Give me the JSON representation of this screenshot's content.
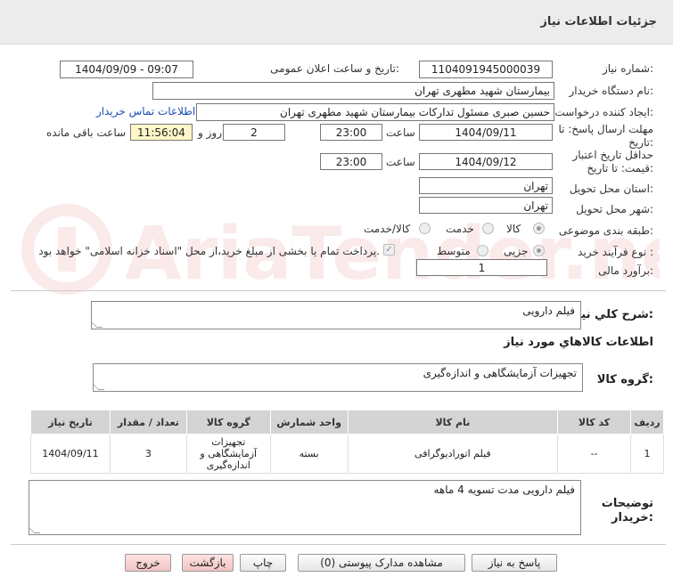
{
  "header": {
    "title": "جزئیات اطلاعات نیاز"
  },
  "labels": {
    "need_number": "شماره نیاز:",
    "announce_datetime": "تاریخ و ساعت اعلان عمومی:",
    "buyer_org": "نام دستگاه خریدار:",
    "requester": "ایجاد کننده درخواست:",
    "contact_link": "اطلاعات تماس خریدار",
    "reply_deadline_1": "مهلت ارسال پاسخ: تا",
    "reply_deadline_2": "تاریخ:",
    "time": "ساعت",
    "day_and": "روز و",
    "remaining": "ساعت باقی مانده",
    "validity_1": "حداقل تاریخ اعتبار",
    "validity_2": "قیمت: تا تاریخ:",
    "province": "استان محل تحویل:",
    "city": "شهر محل تحویل:",
    "category": "طبقه بندی موضوعی:",
    "purchase_type": "نوع فرآیند خرید :",
    "budget": "برآورد مالی:",
    "need_summary": "شرح كلي نياز:",
    "goods_info": "اطلاعات كالاهاي مورد نياز",
    "goods_group": "گروه کالا:",
    "buyer_notes_1": "توضیحات",
    "buyer_notes_2": "خریدار:"
  },
  "values": {
    "need_number": "1104091945000039",
    "announce_datetime": "1404/09/09 - 09:07",
    "buyer_org": "بیمارستان شهید مطهری تهران",
    "requester": "حسین صبری مسئول تدارکات بیمارستان شهید مطهری تهران",
    "reply_date": "1404/09/11",
    "reply_time": "23:00",
    "days": "2",
    "remaining_time": "11:56:04",
    "validity_date": "1404/09/12",
    "validity_time": "23:00",
    "province": "تهران",
    "city": "تهران",
    "budget": "1",
    "need_summary": "فیلم دارویی",
    "goods_group": "تجهیزات آزمایشگاهی و اندازه‌گیری",
    "buyer_notes": "فیلم دارویی  مدت تسویه 4 ماهه"
  },
  "category_options": [
    {
      "label": "کالا",
      "selected": true
    },
    {
      "label": "خدمت",
      "selected": false
    },
    {
      "label": "کالا/خدمت",
      "selected": false
    }
  ],
  "purchase_options": [
    {
      "label": "جزیی",
      "selected": true
    },
    {
      "label": "متوسط",
      "selected": false
    }
  ],
  "payment_note": "پرداخت تمام یا بخشی از مبلغ خرید،از محل \"اسناد خزانه اسلامی\" خواهد بود.",
  "table": {
    "headers": [
      "ردیف",
      "کد کالا",
      "نام کالا",
      "واحد شمارش",
      "گروه کالا",
      "تعداد / مقدار",
      "تاریخ نیاز"
    ],
    "rows": [
      [
        "1",
        "--",
        "فیلم اتورادیوگرافی",
        "بسته",
        "تجهیزات آزمایشگاهی و اندازه‌گیری",
        "3",
        "1404/09/11"
      ]
    ]
  },
  "buttons": {
    "reply": "پاسخ به نیاز",
    "view_docs": "مشاهده مدارک پیوستی (0)",
    "print": "چاپ",
    "back": "بازگشت",
    "exit": "خروج"
  },
  "watermark": "AriaTender.neT",
  "colors": {
    "header_bg": "#ececec",
    "highlight": "#fff7c9",
    "link": "#1a4fb5",
    "table_header": "#d4d4d4"
  }
}
